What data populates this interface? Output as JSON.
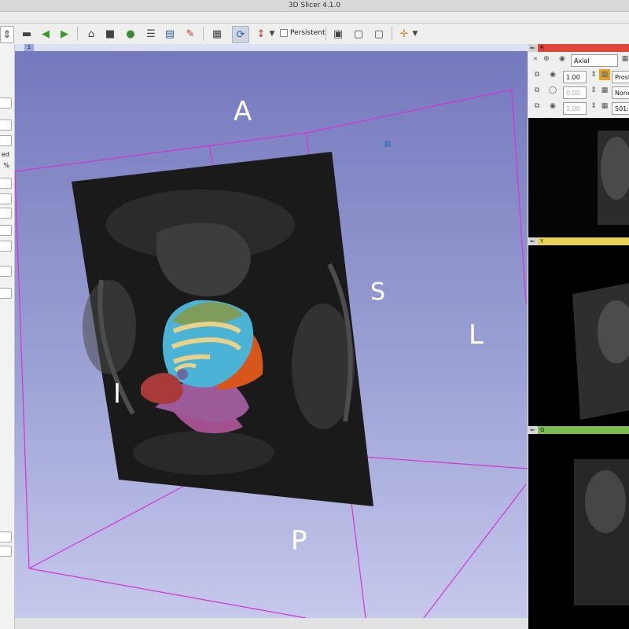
{
  "window": {
    "title": "3D Slicer 4.1.0"
  },
  "toolbar": {
    "persistent_label": "Persistent"
  },
  "left_panel": {
    "texts": [
      "ed",
      "%"
    ]
  },
  "view3d": {
    "tab_number": "1",
    "orientation_labels": {
      "anterior": "A",
      "posterior": "P",
      "superior": "S",
      "inferior": "I",
      "left": "L"
    }
  },
  "slice_views": {
    "red": {
      "letter": "R",
      "orientation": "Axial",
      "opacity": "1.00",
      "label_layer": "Prost",
      "foreground_layer": "None",
      "background_opacity": "0.00",
      "second_opacity": "1.00",
      "slice_index": "501:"
    },
    "yellow": {
      "letter": "Y"
    },
    "green": {
      "letter": "G"
    }
  },
  "colors": {
    "red_bar": "#e0453a",
    "yellow_bar": "#e8d35a",
    "green_bar": "#7dbb53",
    "bbox": "#d434d4",
    "background_top": "#7478bd",
    "background_bottom": "#c6c8ec"
  },
  "icons": [
    "module-dropdown",
    "back-arrow",
    "forward-arrow",
    "home",
    "cube",
    "ribbon",
    "layers",
    "chart",
    "pen",
    "screenshot",
    "rotate",
    "crosshair"
  ]
}
